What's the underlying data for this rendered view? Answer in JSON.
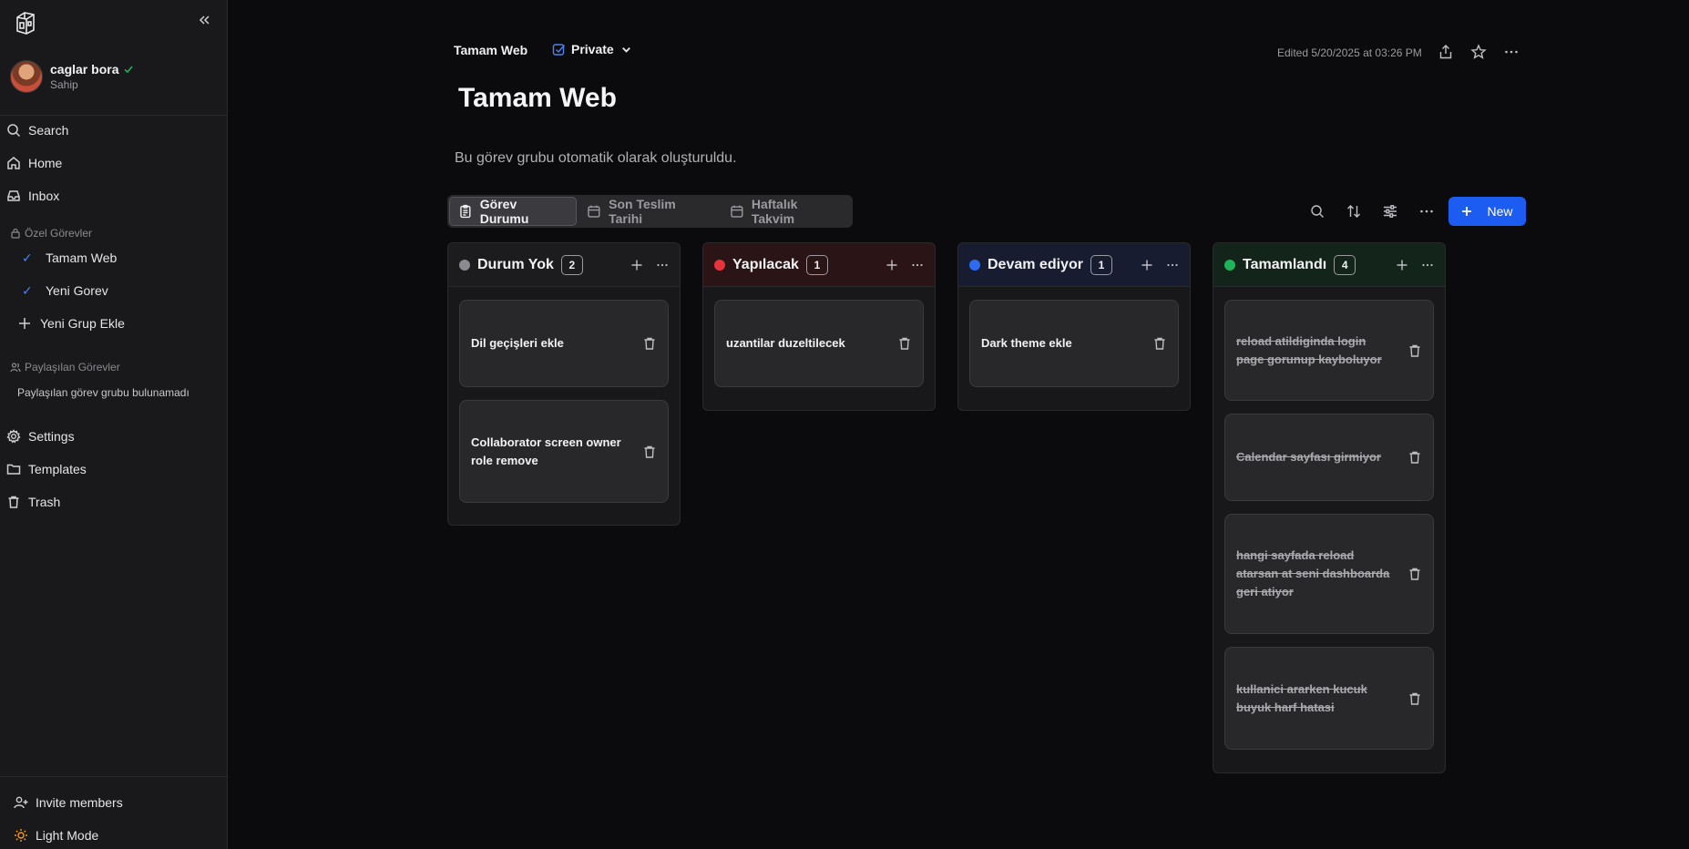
{
  "sidebar": {
    "user": {
      "name": "caglar bora",
      "role": "Sahip"
    },
    "nav": [
      {
        "label": "Search",
        "icon": "search-icon"
      },
      {
        "label": "Home",
        "icon": "home-icon"
      },
      {
        "label": "Inbox",
        "icon": "inbox-icon"
      }
    ],
    "private_section": "Özel Görevler",
    "private_groups": [
      {
        "label": "Tamam Web"
      },
      {
        "label": "Yeni Gorev"
      }
    ],
    "add_group_label": "Yeni Grup Ekle",
    "shared_section": "Paylaşılan Görevler",
    "shared_empty": "Paylaşılan görev grubu bulunamadı",
    "bottom_nav": [
      {
        "label": "Settings",
        "icon": "settings-icon"
      },
      {
        "label": "Templates",
        "icon": "folder-icon"
      },
      {
        "label": "Trash",
        "icon": "trash-icon"
      }
    ],
    "invite_label": "Invite members",
    "theme_label": "Light Mode"
  },
  "header": {
    "breadcrumb": "Tamam Web",
    "privacy": "Private",
    "edited": "Edited 5/20/2025 at 03:26 PM"
  },
  "page": {
    "title": "Tamam Web",
    "description": "Bu görev grubu otomatik olarak oluşturuldu."
  },
  "tabs": [
    {
      "label": "Görev Durumu",
      "active": true
    },
    {
      "label": "Son Teslim Tarihi",
      "active": false
    },
    {
      "label": "Haftalık Takvim",
      "active": false
    }
  ],
  "toolbar": {
    "new_label": "New"
  },
  "colors": {
    "accent": "#1d5cf0",
    "status_none": "#8a8a90",
    "status_todo": "#e5343b",
    "status_progress": "#2f6bf0",
    "status_done": "#1fb35a"
  },
  "columns": [
    {
      "title": "Durum Yok",
      "count": "2",
      "cards": [
        "Dil geçişleri ekle",
        "Collaborator screen owner role remove"
      ]
    },
    {
      "title": "Yapılacak",
      "count": "1",
      "cards": [
        "uzantilar duzeltilecek"
      ]
    },
    {
      "title": "Devam ediyor",
      "count": "1",
      "cards": [
        "Dark theme ekle"
      ]
    },
    {
      "title": "Tamamlandı",
      "count": "4",
      "cards": [
        "reload atildiginda login page gorunup kayboluyor",
        "Calendar sayfası girmiyor",
        "hangi sayfada reload atarsan at seni dashboarda geri atiyor",
        "kullanici ararken kucuk buyuk harf hatasi"
      ]
    }
  ]
}
